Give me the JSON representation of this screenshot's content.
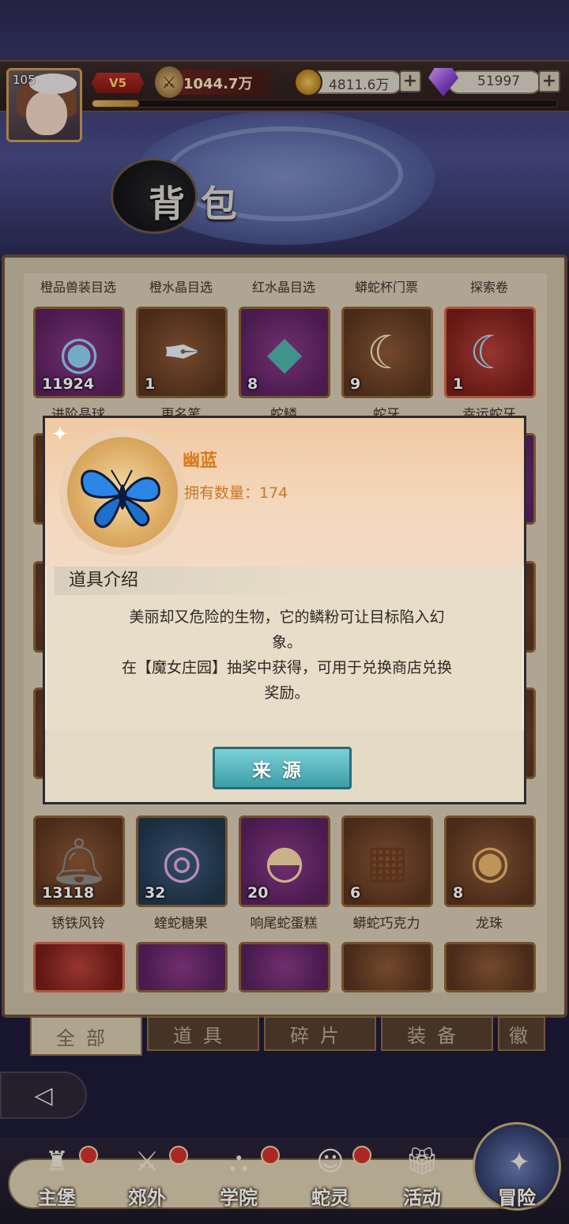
{
  "header": {
    "level": "105",
    "vip": "V5",
    "power": "1044.7万",
    "gold": "4811.6万",
    "gems": "51997",
    "plus": "+",
    "exp_fraction": 0.1
  },
  "page_title": "背包",
  "categories": [
    "橙品兽装目选",
    "橙水晶目选",
    "红水晶目选",
    "蟒蛇杯门票",
    "探索卷"
  ],
  "row1": [
    {
      "count": "11924",
      "name": "进阶晶球"
    },
    {
      "count": "1",
      "name": "更名笔"
    },
    {
      "count": "8",
      "name": "蛇鳞"
    },
    {
      "count": "9",
      "name": "蛇牙"
    },
    {
      "count": "1",
      "name": "幸运蛇牙"
    }
  ],
  "row5": [
    {
      "count": "13118",
      "name": "锈铁风铃"
    },
    {
      "count": "32",
      "name": "蝰蛇糖果"
    },
    {
      "count": "20",
      "name": "响尾蛇蛋糕"
    },
    {
      "count": "6",
      "name": "蟒蛇巧克力"
    },
    {
      "count": "8",
      "name": "龙珠"
    }
  ],
  "tabs": [
    "全部",
    "道具",
    "碎片",
    "装备",
    "徽"
  ],
  "nav": [
    "主堡",
    "郊外",
    "学院",
    "蛇灵",
    "活动",
    "冒险"
  ],
  "popup": {
    "name": "幽蓝",
    "owned": "拥有数量：174",
    "section": "道具介绍",
    "desc1": "美丽却又危险的生物，它的鳞粉可让目标陷入幻",
    "desc2": "象。",
    "desc3": "在【魔女庄园】抽奖中获得，可用于兑换商店兑换",
    "desc4": "奖励。",
    "button": "来源"
  }
}
